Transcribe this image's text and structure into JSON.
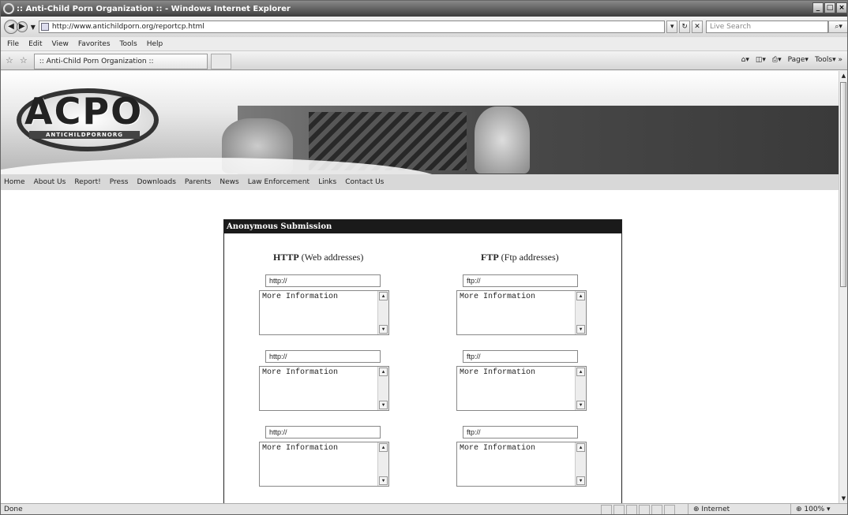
{
  "window": {
    "title": ":: Anti-Child Porn Organization :: - Windows Internet Explorer",
    "controls": [
      "_",
      "□",
      "×"
    ]
  },
  "address": {
    "url": "http://www.antichildporn.org/reportcp.html",
    "search_placeholder": "Live Search"
  },
  "menu": [
    "File",
    "Edit",
    "View",
    "Favorites",
    "Tools",
    "Help"
  ],
  "tab": {
    "title": ":: Anti-Child Porn Organization ::"
  },
  "toolbar": {
    "page_label": "Page",
    "tools_label": "Tools"
  },
  "site": {
    "logo_text": "ACPO",
    "logo_sub": "ANTICHILDPORNORG",
    "nav": [
      "Home",
      "About Us",
      "Report!",
      "Press",
      "Downloads",
      "Parents",
      "News",
      "Law Enforcement",
      "Links",
      "Contact Us"
    ]
  },
  "form": {
    "title": "Anonymous Submission",
    "http_head_bold": "HTTP",
    "http_head_rest": "(Web addresses)",
    "ftp_head_bold": "FTP",
    "ftp_head_rest": "(Ftp addresses)",
    "http_rows": [
      {
        "url": "http://",
        "info": "More Information"
      },
      {
        "url": "http://",
        "info": "More Information"
      },
      {
        "url": "http://",
        "info": "More Information"
      }
    ],
    "ftp_rows": [
      {
        "url": "ftp://",
        "info": "More Information"
      },
      {
        "url": "ftp://",
        "info": "More Information"
      },
      {
        "url": "ftp://",
        "info": "More Information"
      }
    ]
  },
  "status": {
    "text": "Done",
    "zone": "Internet",
    "zoom": "100%"
  }
}
